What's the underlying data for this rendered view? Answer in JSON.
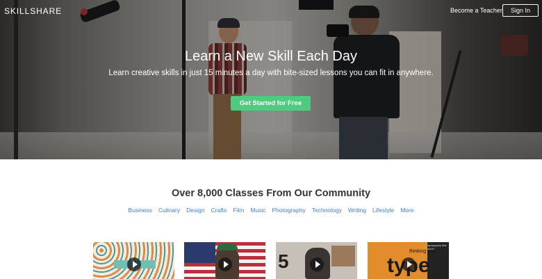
{
  "header": {
    "brand": "SKILLSHARE",
    "teacher_link": "Become a Teacher",
    "signin_label": "Sign In"
  },
  "hero": {
    "title": "Learn a New Skill Each Day",
    "subtitle": "Learn creative skills in just 15 minutes a day with bite-sized lessons you can fit in anywhere.",
    "cta_label": "Get Started for Free"
  },
  "community": {
    "title": "Over 8,000 Classes From Our Community",
    "categories": [
      "Business",
      "Culinary",
      "Design",
      "Crafts",
      "Film",
      "Music",
      "Photography",
      "Technology",
      "Writing",
      "Lifestyle",
      "More"
    ]
  },
  "thumbnails": [
    {
      "icon": "play-icon"
    },
    {
      "icon": "play-icon"
    },
    {
      "icon": "play-icon",
      "overlay_text": "5"
    },
    {
      "icon": "play-icon",
      "overlay_text_1": "thinking with",
      "overlay_text_2": "type",
      "overlay_text_3": "typography that works"
    }
  ],
  "colors": {
    "cta": "#4fcb7f",
    "link": "#3d7ed6",
    "heading": "#333333"
  }
}
